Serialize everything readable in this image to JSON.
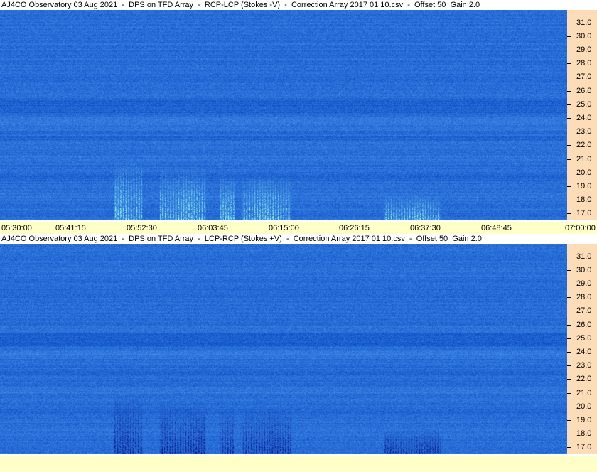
{
  "panels": [
    {
      "title": "AJ4CO Observatory 03 Aug 2021  -  DPS on TFD Array  -  RCP-LCP (Stokes -V)  -  Correction Array 2017 01 10.csv  -  Offset 50  Gain 2.0",
      "mode": "bright",
      "freq_labels": [
        "31.0",
        "30.0",
        "29.0",
        "28.0",
        "27.0",
        "26.0",
        "25.0",
        "24.0",
        "23.0",
        "22.0",
        "21.0",
        "20.0",
        "19.0",
        "18.0",
        "17.0"
      ],
      "time_labels": [
        "05:30:00",
        "05:41:15",
        "05:52:30",
        "06:03:45",
        "06:15:00",
        "06:26:15",
        "06:37:30",
        "06:48:45",
        "07:00:00"
      ]
    },
    {
      "title": "AJ4CO Observatory 03 Aug 2021  -  DPS on TFD Array  -  LCP-RCP (Stokes +V)  -  Correction Array 2017 01 10.csv  -  Offset 50  Gain 2.0",
      "mode": "dark",
      "freq_labels": [
        "31.0",
        "30.0",
        "29.0",
        "28.0",
        "27.0",
        "26.0",
        "25.0",
        "24.0",
        "23.0",
        "22.0",
        "21.0",
        "20.0",
        "19.0",
        "18.0",
        "17.0"
      ],
      "time_labels": []
    }
  ],
  "colors": {
    "spectrogram_base": "#2b6fd9",
    "freq_axis_bg": "#fddcb8",
    "time_axis_bg": "#ffffc8"
  }
}
